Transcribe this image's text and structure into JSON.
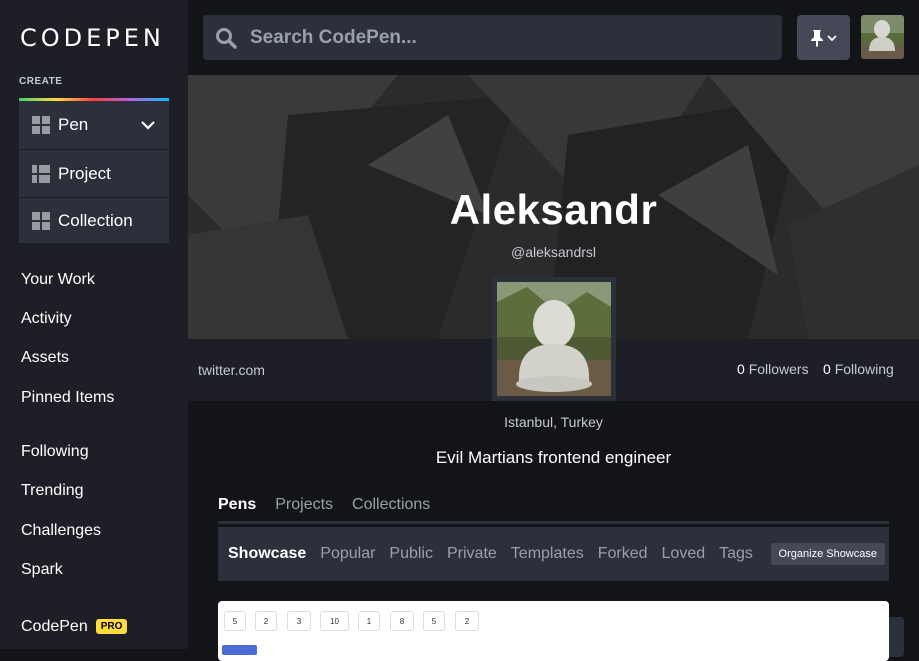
{
  "app": {
    "logo_text": "CODEPEN"
  },
  "sidebar": {
    "create_label": "CREATE",
    "create_items": [
      {
        "label": "Pen"
      },
      {
        "label": "Project"
      },
      {
        "label": "Collection"
      }
    ],
    "nav_items": [
      {
        "label": "Your Work"
      },
      {
        "label": "Activity"
      },
      {
        "label": "Assets"
      },
      {
        "label": "Pinned Items"
      },
      {
        "label": "Following"
      },
      {
        "label": "Trending"
      },
      {
        "label": "Challenges"
      },
      {
        "label": "Spark"
      }
    ],
    "codepen_pro_label": "CodePen",
    "pro_badge": "PRO"
  },
  "search": {
    "placeholder": "Search CodePen..."
  },
  "profile": {
    "name": "Aleksandr",
    "handle": "@aleksandrsl",
    "website": "twitter.com",
    "followers_count": "0",
    "followers_label": "Followers",
    "following_count": "0",
    "following_label": "Following",
    "location": "Istanbul, Turkey",
    "bio": "Evil Martians frontend engineer"
  },
  "tabs": [
    {
      "label": "Pens"
    },
    {
      "label": "Projects"
    },
    {
      "label": "Collections"
    }
  ],
  "subtabs": [
    {
      "label": "Showcase"
    },
    {
      "label": "Popular"
    },
    {
      "label": "Public"
    },
    {
      "label": "Private"
    },
    {
      "label": "Templates"
    },
    {
      "label": "Forked"
    },
    {
      "label": "Loved"
    },
    {
      "label": "Tags"
    }
  ],
  "organize_label": "Organize Showcase",
  "preview_numbers": [
    "5",
    "2",
    "3",
    "10",
    "1",
    "8",
    "5",
    "2"
  ],
  "colors": {
    "background": "#131417",
    "sidebar": "#1e1f26",
    "panel": "#2c303a",
    "button": "#444857",
    "pro_badge": "#ffdd40"
  }
}
